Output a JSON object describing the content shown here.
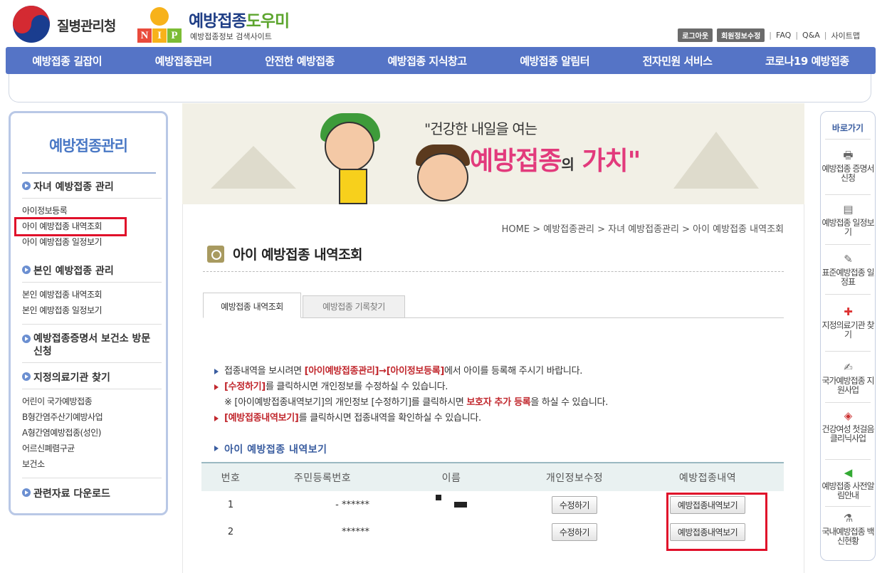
{
  "header": {
    "agency_name": "질병관리청",
    "site_title_a": "예방접종",
    "site_title_b": "도우미",
    "site_subtitle": "예방접종정보 검색사이트",
    "nip_letters": [
      "N",
      "I",
      "P"
    ],
    "util": {
      "logout": "로그아웃",
      "edit_member": "회원정보수정",
      "faq": "FAQ",
      "qna": "Q&A",
      "sitemap": "사이트맵"
    }
  },
  "gnb": [
    "예방접종 길잡이",
    "예방접종관리",
    "안전한 예방접종",
    "예방접종 지식창고",
    "예방접종 알림터",
    "전자민원 서비스",
    "코로나19 예방접종"
  ],
  "lnb": {
    "title": "예방접종관리",
    "groups": [
      {
        "label": "자녀 예방접종 관리",
        "items": [
          "아이정보등록",
          "아이 예방접종 내역조회",
          "아이 예방접종 일정보기"
        ]
      },
      {
        "label": "본인 예방접종 관리",
        "items": [
          "본인 예방접종 내역조회",
          "본인 예방접종 일정보기"
        ]
      },
      {
        "label": "예방접종증명서 보건소 방문신청",
        "items": []
      },
      {
        "label": "지정의료기관 찾기",
        "items": [
          "어린이 국가예방접종",
          "B형간염주산기예방사업",
          "A형간염예방접종(성인)",
          "어르신폐렴구균",
          "보건소"
        ]
      },
      {
        "label": "관련자료 다운로드",
        "items": []
      }
    ]
  },
  "banner": {
    "line1": "\"건강한 내일을 여는",
    "line2a": "예방접종",
    "line2b": "의",
    "line2c": "가치\""
  },
  "content": {
    "breadcrumb": "HOME > 예방접종관리 > 자녀 예방접종관리 > 아이 예방접종 내역조회",
    "title": "아이 예방접종 내역조회",
    "tabs": [
      "예방접종 내역조회",
      "예방접종 기록찾기"
    ],
    "notice": {
      "r1_pre": "접종내역을 보시려면 ",
      "r1_hl": "[아이예방접종관리]→[아이정보등록]",
      "r1_post": "에서 아이를 등록해 주시기 바랍니다.",
      "r2_hl": "[수정하기]",
      "r2_post": "를 클릭하시면 개인정보를 수정하실 수 있습니다.",
      "r3_pre": "※ [아이예방접종내역보기]의 개인정보 [수정하기]를 클릭하시면 ",
      "r3_hl": "보호자 추가 등록",
      "r3_post": "을 하실 수 있습니다.",
      "r4_hl": "[예방접종내역보기]",
      "r4_post": "를 클릭하시면 접종내역을 확인하실 수 있습니다."
    },
    "section_title": "아이 예방접종 내역보기",
    "table": {
      "headers": [
        "번호",
        "주민등록번호",
        "이름",
        "개인정보수정",
        "예방접종내역"
      ],
      "rows": [
        {
          "no": "1",
          "rrn": "- ******",
          "edit": "수정하기",
          "view": "예방접종내역보기"
        },
        {
          "no": "2",
          "rrn": "******",
          "edit": "수정하기",
          "view": "예방접종내역보기"
        }
      ]
    }
  },
  "quick": {
    "title": "바로가기",
    "items": [
      {
        "label": "예방접종 증명서 신청",
        "icon": "printer-icon"
      },
      {
        "label": "예방접종 일정보기",
        "icon": "calendar-icon"
      },
      {
        "label": "표준예방접종 일정표",
        "icon": "syringe-icon"
      },
      {
        "label": "지정의료기관 찾기",
        "icon": "hospital-icon"
      },
      {
        "label": "국가예방접종 지원사업",
        "icon": "document-icon"
      },
      {
        "label": "건강여성 첫걸음 클리닉사업",
        "icon": "box-icon"
      },
      {
        "label": "예방접종 사전알림안내",
        "icon": "speaker-icon"
      },
      {
        "label": "국내예방접종 백신현황",
        "icon": "vial-icon"
      }
    ]
  },
  "colors": {
    "accent": "#5574c6",
    "highlight_red": "#c1272d",
    "annotation_box": "#e0102a"
  }
}
